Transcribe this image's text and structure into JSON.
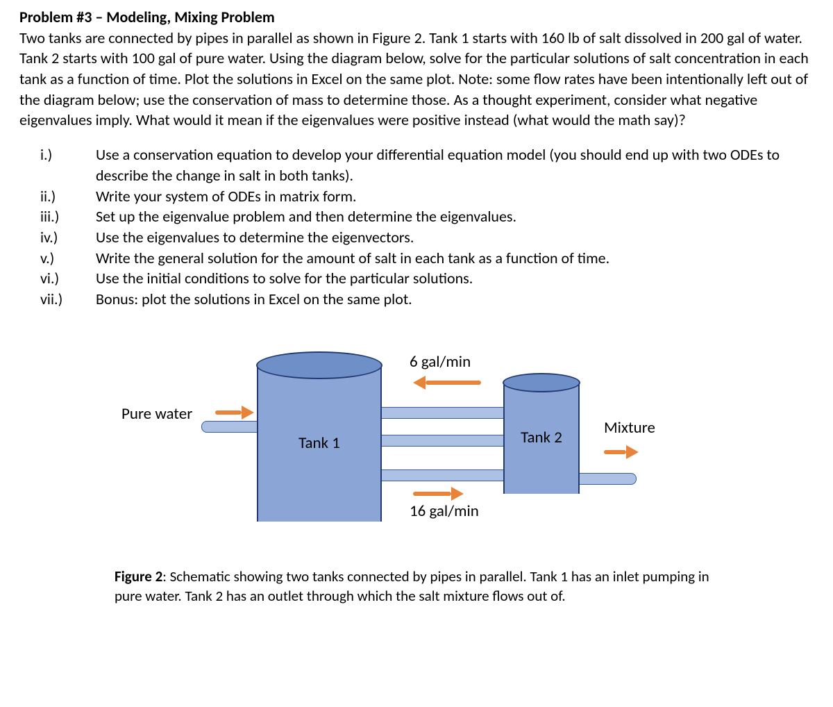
{
  "title": "Problem #3 – Modeling, Mixing Problem",
  "intro": "Two tanks are connected by pipes in parallel as shown in Figure 2. Tank 1 starts with 160 lb of salt dissolved in 200 gal of water. Tank 2 starts with 100 gal of pure water. Using the diagram below, solve for the particular solutions of salt concentration in each tank as a function of time. Plot the solutions in Excel on the same plot. Note: some flow rates have been intentionally left out of the diagram below; use the conservation of mass to determine those. As a thought experiment, consider what negative eigenvalues imply. What would it mean if the eigenvalues were positive instead (what would the math say)?",
  "tasks": [
    {
      "num": "i.)",
      "text": "Use a conservation equation to develop your differential equation model (you should end up with two ODEs to describe the change in salt in both tanks)."
    },
    {
      "num": "ii.)",
      "text": "Write your system of ODEs in matrix form."
    },
    {
      "num": "iii.)",
      "text": "Set up the eigenvalue problem and then determine the eigenvalues."
    },
    {
      "num": "iv.)",
      "text": "Use the eigenvalues to determine the eigenvectors."
    },
    {
      "num": "v.)",
      "text": "Write the general solution for the amount of salt in each tank as a function of time."
    },
    {
      "num": "vi.)",
      "text": "Use the initial conditions to solve for the particular solutions."
    },
    {
      "num": "vii.)",
      "text": "Bonus: plot the solutions in Excel on the same plot."
    }
  ],
  "figure": {
    "pure_water": "Pure water",
    "mixture": "Mixture",
    "tank1": "Tank 1",
    "tank2": "Tank 2",
    "flow_top": "6 gal/min",
    "flow_bot": "16 gal/min",
    "caption_lead": "Figure 2",
    "caption": ": Schematic showing two tanks connected by pipes in parallel. Tank 1 has an inlet pumping in pure water. Tank 2 has an outlet through which the salt mixture flows out of."
  }
}
